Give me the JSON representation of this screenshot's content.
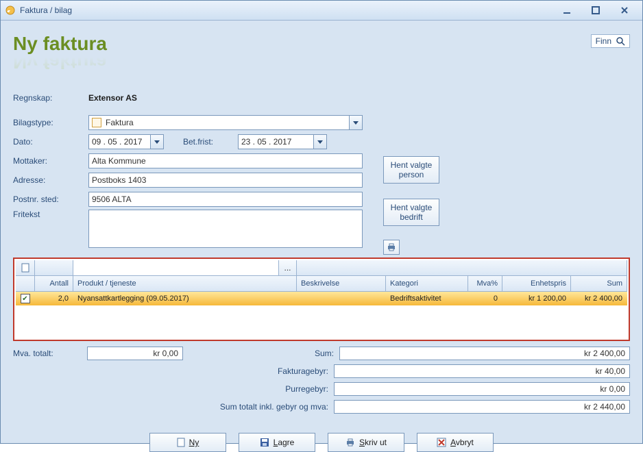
{
  "window": {
    "title": "Faktura / bilag"
  },
  "heading": "Ny faktura",
  "finn_label": "Finn",
  "labels": {
    "regnskap": "Regnskap:",
    "bilagstype": "Bilagstype:",
    "dato": "Dato:",
    "betfrist": "Bet.frist:",
    "mottaker": "Mottaker:",
    "adresse": "Adresse:",
    "postnr": "Postnr. sted:",
    "fritekst": "Fritekst"
  },
  "form": {
    "regnskap": "Extensor AS",
    "bilagstype": "Faktura",
    "dato": "09 . 05 . 2017",
    "betfrist": "23 . 05 . 2017",
    "mottaker": "Alta Kommune",
    "adresse": "Postboks 1403",
    "postnr": "9506 ALTA",
    "fritekst": ""
  },
  "side_buttons": {
    "hent_person": "Hent valgte person",
    "hent_bedrift": "Hent valgte bedrift"
  },
  "grid": {
    "headers": {
      "antall": "Antall",
      "produkt": "Produkt / tjeneste",
      "beskrivelse": "Beskrivelse",
      "kategori": "Kategori",
      "mva": "Mva%",
      "enhetspris": "Enhetspris",
      "sum": "Sum"
    },
    "rows": [
      {
        "checked": true,
        "antall": "2,0",
        "produkt": "Nyansattkartlegging (09.05.2017)",
        "beskrivelse": "",
        "kategori": "Bedriftsaktivitet",
        "mva": "0",
        "enhetspris": "kr 1 200,00",
        "sum": "kr 2 400,00"
      }
    ],
    "toolbar_dots": "..."
  },
  "totals": {
    "mva_totalt_lbl": "Mva. totalt:",
    "mva_totalt": "kr 0,00",
    "sum_lbl": "Sum:",
    "sum": "kr 2 400,00",
    "fakturagebyr_lbl": "Fakturagebyr:",
    "fakturagebyr": "kr 40,00",
    "purregebyr_lbl": "Purregebyr:",
    "purregebyr": "kr 0,00",
    "grand_lbl": "Sum totalt inkl. gebyr og mva:",
    "grand": "kr 2 440,00"
  },
  "buttons": {
    "ny": "Ny",
    "lagre": "Lagre",
    "skrivut": "Skriv ut",
    "avbryt": "Avbryt"
  }
}
